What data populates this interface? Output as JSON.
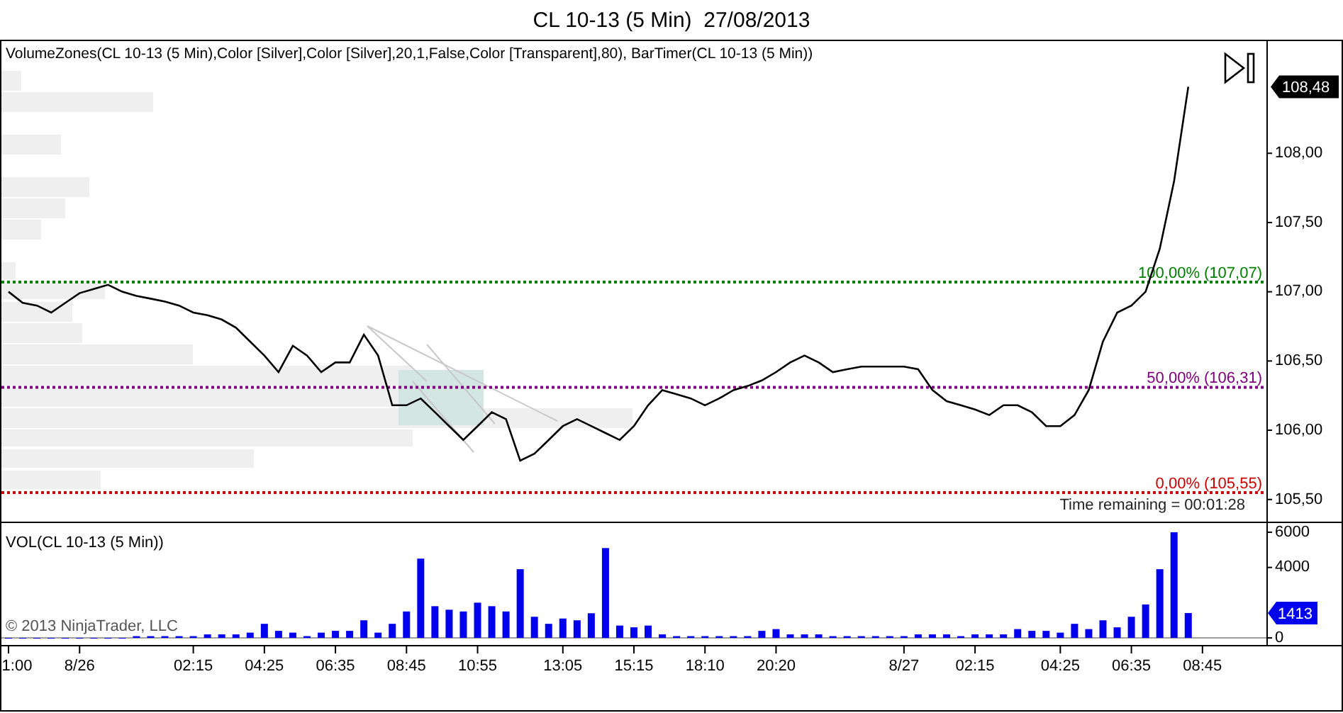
{
  "window": {
    "title": "CL 10-13 (5 Min)  27/08/2013"
  },
  "price_panel": {
    "indicator_label": "VolumeZones(CL 10-13 (5 Min),Color [Silver],Color [Silver],20,1,False,Color [Transparent],80), BarTimer(CL 10-13 (5 Min))",
    "last_price_label": "108,48",
    "timer": "Time remaining = 00:01:28",
    "chart_data": {
      "type": "line",
      "ylim": [
        105.34,
        108.81
      ],
      "categories": [
        null,
        null,
        null,
        null,
        null,
        null,
        null,
        null,
        null,
        null,
        null,
        null,
        null,
        null,
        null,
        null,
        null,
        null,
        null,
        null,
        null,
        null,
        null,
        null,
        null,
        null,
        null,
        null,
        null,
        null,
        null,
        null,
        null,
        null,
        null,
        null,
        null,
        null,
        null,
        null,
        null,
        null,
        null,
        null,
        null,
        null,
        null,
        null,
        null,
        null,
        null,
        null,
        null,
        null,
        null,
        null,
        null,
        null,
        null,
        null,
        null,
        null,
        null,
        null,
        null,
        null,
        null,
        null,
        null,
        null,
        null,
        null,
        null,
        null,
        null,
        null,
        null,
        null,
        null,
        null,
        null,
        null,
        null,
        null,
        null,
        null,
        null,
        null,
        null
      ],
      "series": [
        {
          "color": "#000000",
          "values": [
            107.0,
            106.92,
            106.9,
            106.85,
            106.92,
            106.99,
            107.02,
            107.05,
            107.0,
            106.97,
            106.95,
            106.93,
            106.9,
            106.85,
            106.83,
            106.8,
            106.74,
            106.64,
            106.54,
            106.42,
            106.61,
            106.54,
            106.42,
            106.49,
            106.49,
            106.69,
            106.54,
            106.18,
            106.18,
            106.23,
            106.13,
            106.03,
            105.93,
            106.03,
            106.13,
            106.08,
            105.78,
            105.83,
            105.93,
            106.03,
            106.08,
            106.03,
            105.98,
            105.93,
            106.03,
            106.18,
            106.29,
            106.26,
            106.23,
            106.18,
            106.23,
            106.29,
            106.32,
            106.36,
            106.42,
            106.49,
            106.54,
            106.49,
            106.42,
            106.44,
            106.46,
            106.46,
            106.46,
            106.46,
            106.44,
            106.29,
            106.21,
            106.18,
            106.15,
            106.11,
            106.18,
            106.18,
            106.13,
            106.03,
            106.03,
            106.11,
            106.29,
            106.64,
            106.85,
            106.9,
            107.0,
            107.31,
            107.8,
            108.48,
            null,
            null,
            null,
            null,
            null
          ]
        }
      ],
      "yticks": [
        {
          "value": 105.5,
          "label": "105,50"
        },
        {
          "value": 106,
          "label": "106,00"
        },
        {
          "value": 106.5,
          "label": "106,50"
        },
        {
          "value": 107,
          "label": "107,00"
        },
        {
          "value": 107.5,
          "label": "107,50"
        },
        {
          "value": 108,
          "label": "108,00"
        }
      ],
      "ref_lines": [
        {
          "axis": "y",
          "value": 107.07,
          "label": "100,00% (107,07)",
          "color": "#008000"
        },
        {
          "axis": "y",
          "value": 106.31,
          "label": "50,00% (106,31)",
          "color": "#800080"
        },
        {
          "axis": "y",
          "value": 105.55,
          "label": "0,00% (105,55)",
          "color": "#cc0000"
        }
      ]
    }
  },
  "volume_panel": {
    "title": "VOL(CL 10-13 (5 Min))",
    "copyright": "© 2013 NinjaTrader, LLC",
    "last_value_label": "1413",
    "chart_data": {
      "type": "bar",
      "ylim": [
        -400,
        6600
      ],
      "categories": [
        "1:00",
        null,
        null,
        null,
        null,
        "8/26",
        null,
        null,
        null,
        null,
        null,
        null,
        null,
        "02:15",
        null,
        null,
        null,
        null,
        "04:25",
        null,
        null,
        null,
        null,
        "06:35",
        null,
        null,
        null,
        null,
        "08:45",
        null,
        null,
        null,
        null,
        "10:55",
        null,
        null,
        null,
        null,
        null,
        "13:05",
        null,
        null,
        null,
        null,
        "15:15",
        null,
        null,
        null,
        null,
        "18:10",
        null,
        null,
        null,
        null,
        "20:20",
        null,
        null,
        null,
        null,
        null,
        null,
        null,
        null,
        "8/27",
        null,
        null,
        null,
        null,
        "02:15",
        null,
        null,
        null,
        null,
        null,
        "04:25",
        null,
        null,
        null,
        null,
        "06:35",
        null,
        null,
        null,
        null,
        "08:45",
        null,
        null,
        null,
        null
      ],
      "series": [
        {
          "color": "#0000ee",
          "values": [
            0,
            0,
            0,
            0,
            0,
            0,
            0,
            0,
            0,
            100,
            100,
            100,
            100,
            100,
            200,
            200,
            200,
            300,
            800,
            400,
            300,
            100,
            300,
            400,
            400,
            1000,
            300,
            800,
            1500,
            4500,
            1800,
            1600,
            1500,
            2000,
            1800,
            1500,
            3900,
            1200,
            800,
            1100,
            1000,
            1400,
            5100,
            700,
            600,
            700,
            200,
            100,
            100,
            100,
            100,
            100,
            100,
            400,
            500,
            200,
            200,
            200,
            100,
            100,
            100,
            100,
            100,
            100,
            200,
            200,
            200,
            100,
            200,
            200,
            200,
            500,
            400,
            400,
            300,
            800,
            500,
            1000,
            600,
            1200,
            1900,
            3900,
            6000,
            1413,
            null,
            null,
            null,
            null,
            null
          ]
        }
      ],
      "yticks": [
        0,
        4000,
        6000
      ]
    }
  }
}
